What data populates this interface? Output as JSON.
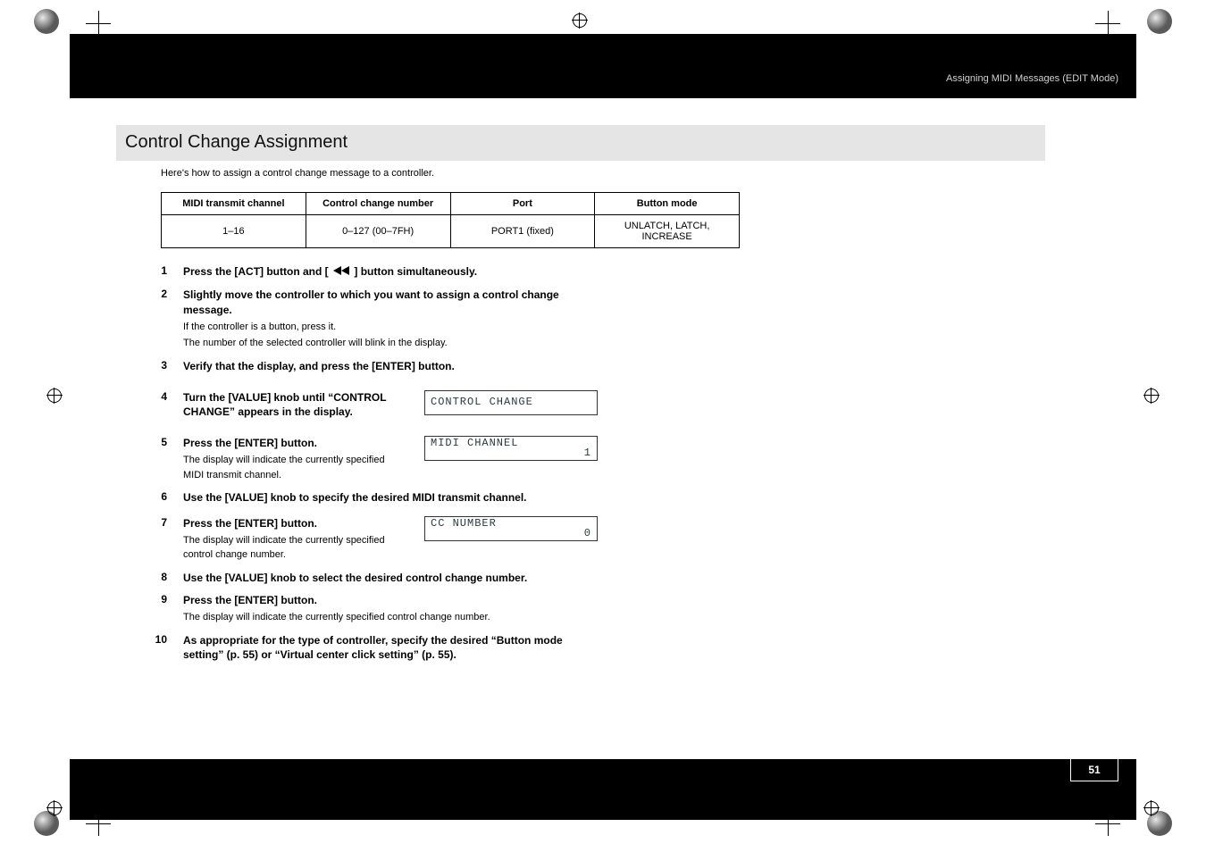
{
  "header_right": "Assigning MIDI Messages (EDIT Mode)",
  "page_number": "51",
  "section_title": "Control Change Assignment",
  "intro": "Here's how to assign a control change message to a controller.",
  "table": {
    "headers": [
      "MIDI transmit channel",
      "Control change number",
      "Port",
      "Button mode"
    ],
    "row": [
      "1–16",
      "0–127 (00–7FH)",
      "PORT1 (fixed)",
      "UNLATCH, LATCH, INCREASE"
    ]
  },
  "steps": [
    {
      "n": "1",
      "title_a": "Press the [ACT] button and [",
      "title_b": "] button simultaneously."
    },
    {
      "n": "2",
      "title": "Slightly move the controller to which you want to assign a control change message.",
      "sub1": "If the controller is a button, press it.",
      "sub2": "The number of the selected controller will blink in the display."
    },
    {
      "n": "3",
      "title": "Verify that the display, and press the [ENTER] button."
    },
    {
      "n": "4",
      "title": "Turn the [VALUE] knob until “CONTROL CHANGE” appears in the display.",
      "lcd": "CONTROL CHANGE"
    },
    {
      "n": "5",
      "title": "Press the [ENTER] button.",
      "sub1": "The display will indicate the currently specified MIDI transmit channel.",
      "lcd": "MIDI CHANNEL",
      "lcd_val": "1"
    },
    {
      "n": "6",
      "title": "Use the [VALUE] knob to specify the desired MIDI transmit channel."
    },
    {
      "n": "7",
      "title": "Press the [ENTER] button.",
      "sub1": "The display will indicate the currently specified control change number.",
      "lcd": "CC NUMBER",
      "lcd_val": "0"
    },
    {
      "n": "8",
      "title": "Use the [VALUE] knob to select the desired control change number."
    },
    {
      "n": "9",
      "title": "Press the [ENTER] button.",
      "sub1": "The display will indicate the currently specified control change number."
    },
    {
      "n": "10",
      "title": "As appropriate for the type of controller, specify the desired  “Button mode setting” (p. 55) or  “Virtual center click setting” (p. 55)."
    }
  ]
}
